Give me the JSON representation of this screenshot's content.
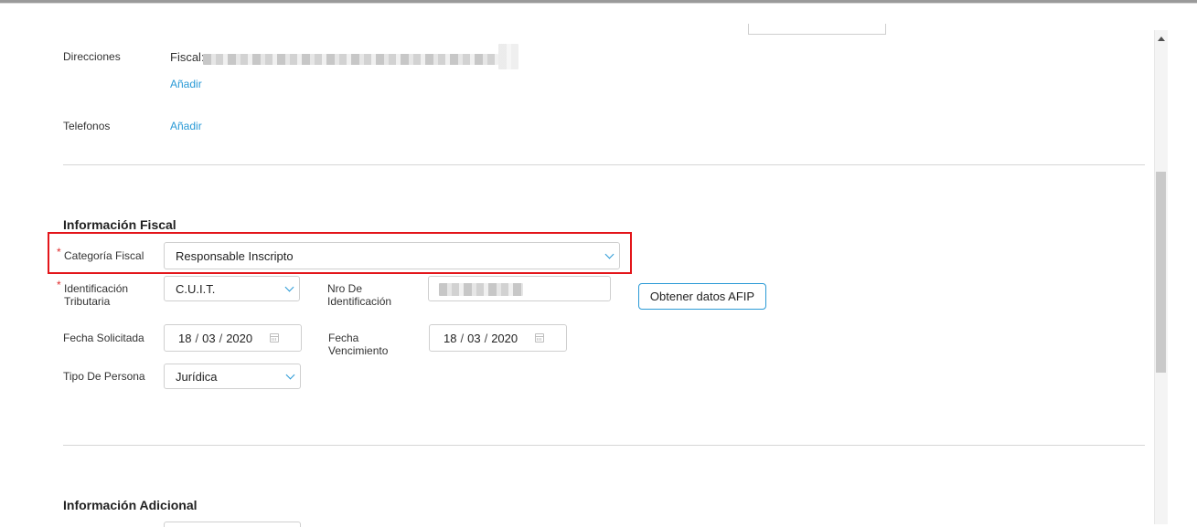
{
  "contact": {
    "direcciones_label": "Direcciones",
    "fiscal_label": "Fiscal:",
    "add_address_link": "Añadir",
    "telefonos_label": "Telefonos",
    "add_phone_link": "Añadir"
  },
  "fiscal_section": {
    "title": "Información Fiscal",
    "required_mark": "*",
    "categoria_label": "Categoría Fiscal",
    "categoria_value": "Responsable Inscripto",
    "identificacion_label_1": "Identificación",
    "identificacion_label_2": "Tributaria",
    "identificacion_value": "C.U.I.T.",
    "nro_label_1": "Nro De",
    "nro_label_2": "Identificación",
    "afip_button": "Obtener datos AFIP",
    "fecha_solicitada_label": "Fecha Solicitada",
    "fecha_solicitada": {
      "day": "18",
      "month": "03",
      "year": "2020"
    },
    "fecha_venc_label_1": "Fecha",
    "fecha_venc_label_2": "Vencimiento",
    "fecha_vencimiento": {
      "day": "18",
      "month": "03",
      "year": "2020"
    },
    "date_sep": "/",
    "tipo_persona_label": "Tipo De Persona",
    "tipo_persona_value": "Jurídica"
  },
  "additional_section": {
    "title": "Información Adicional"
  },
  "colors": {
    "accent": "#2a9ad6",
    "highlight": "#e3151a",
    "required": "#e02b2b"
  }
}
